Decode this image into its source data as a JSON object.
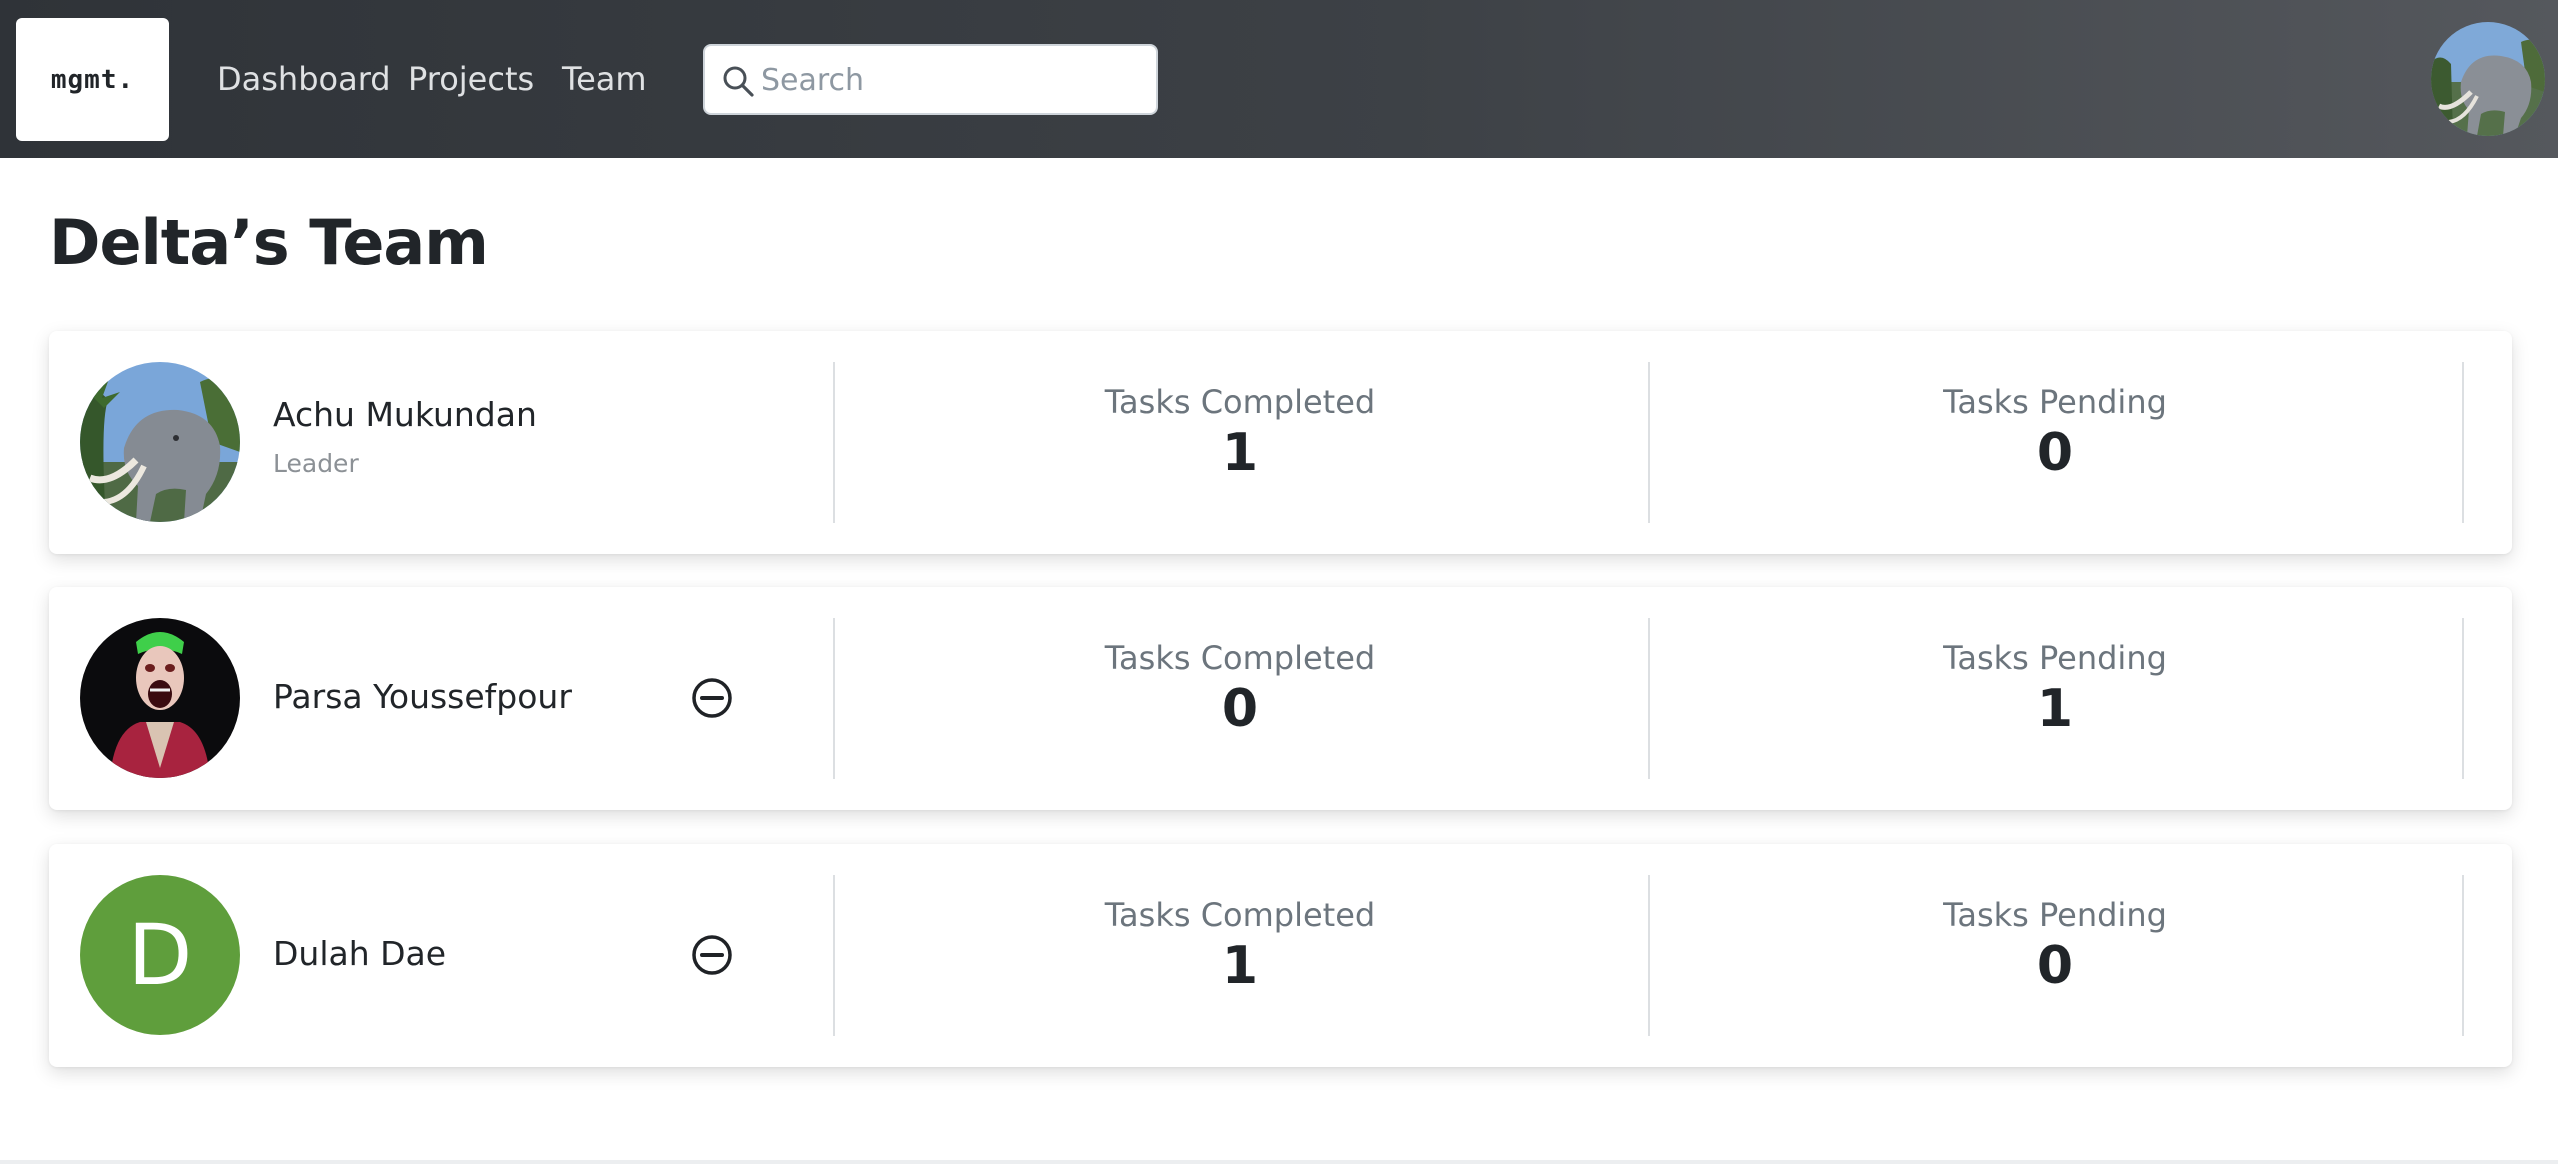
{
  "navbar": {
    "logo": "mgmt.",
    "links": [
      "Dashboard",
      "Projects",
      "Team"
    ],
    "search": {
      "placeholder": "Search",
      "value": ""
    }
  },
  "page": {
    "title": "Delta’s Team"
  },
  "members": [
    {
      "name": "Achu Mukundan",
      "role": "Leader",
      "avatar": "photo-elephant-statue",
      "tasks_completed_label": "Tasks Completed",
      "tasks_completed": "1",
      "tasks_pending_label": "Tasks Pending",
      "tasks_pending": "0"
    },
    {
      "name": "Parsa Youssefpour",
      "avatar": "photo-joker-illustration",
      "tasks_completed_label": "Tasks Completed",
      "tasks_completed": "0",
      "tasks_pending_label": "Tasks Pending",
      "tasks_pending": "1"
    },
    {
      "name": "Dulah Dae",
      "avatar_letter": "D",
      "avatar_color": "#5f9e3c",
      "tasks_completed_label": "Tasks Completed",
      "tasks_completed": "1",
      "tasks_pending_label": "Tasks Pending",
      "tasks_pending": "0"
    }
  ],
  "colors": {
    "navbar": "#3d4146",
    "accent_avatar": "#5f9e3c",
    "muted_text": "#6c757d"
  },
  "icons": {
    "search": "search-icon",
    "remove": "remove-circle-icon"
  }
}
